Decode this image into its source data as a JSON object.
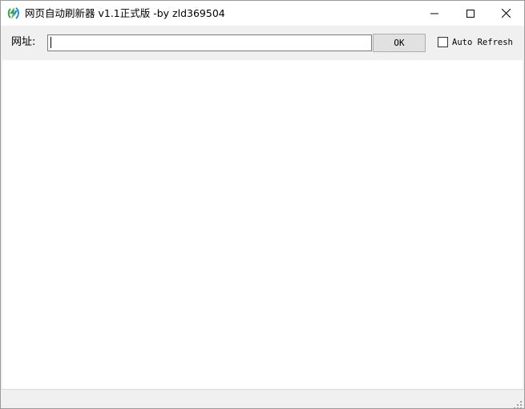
{
  "window": {
    "title": "网页自动刷新器 v1.1正式版 -by zld369504",
    "app_icon": "refresh-arrows-icon",
    "controls": [
      "minimize-icon",
      "maximize-icon",
      "close-icon"
    ]
  },
  "toolbar": {
    "url_label": "网址:",
    "url_value": "",
    "ok_label": "OK",
    "auto_refresh_label": "Auto Refresh",
    "auto_refresh_checked": false
  },
  "statusbar": {
    "text": ""
  },
  "colors": {
    "chrome_bg": "#f0f0f0",
    "titlebar_bg": "#ffffff",
    "button_bg": "#e1e1e1",
    "icon_green": "#3aa14a",
    "icon_blue": "#2a8fd6"
  }
}
